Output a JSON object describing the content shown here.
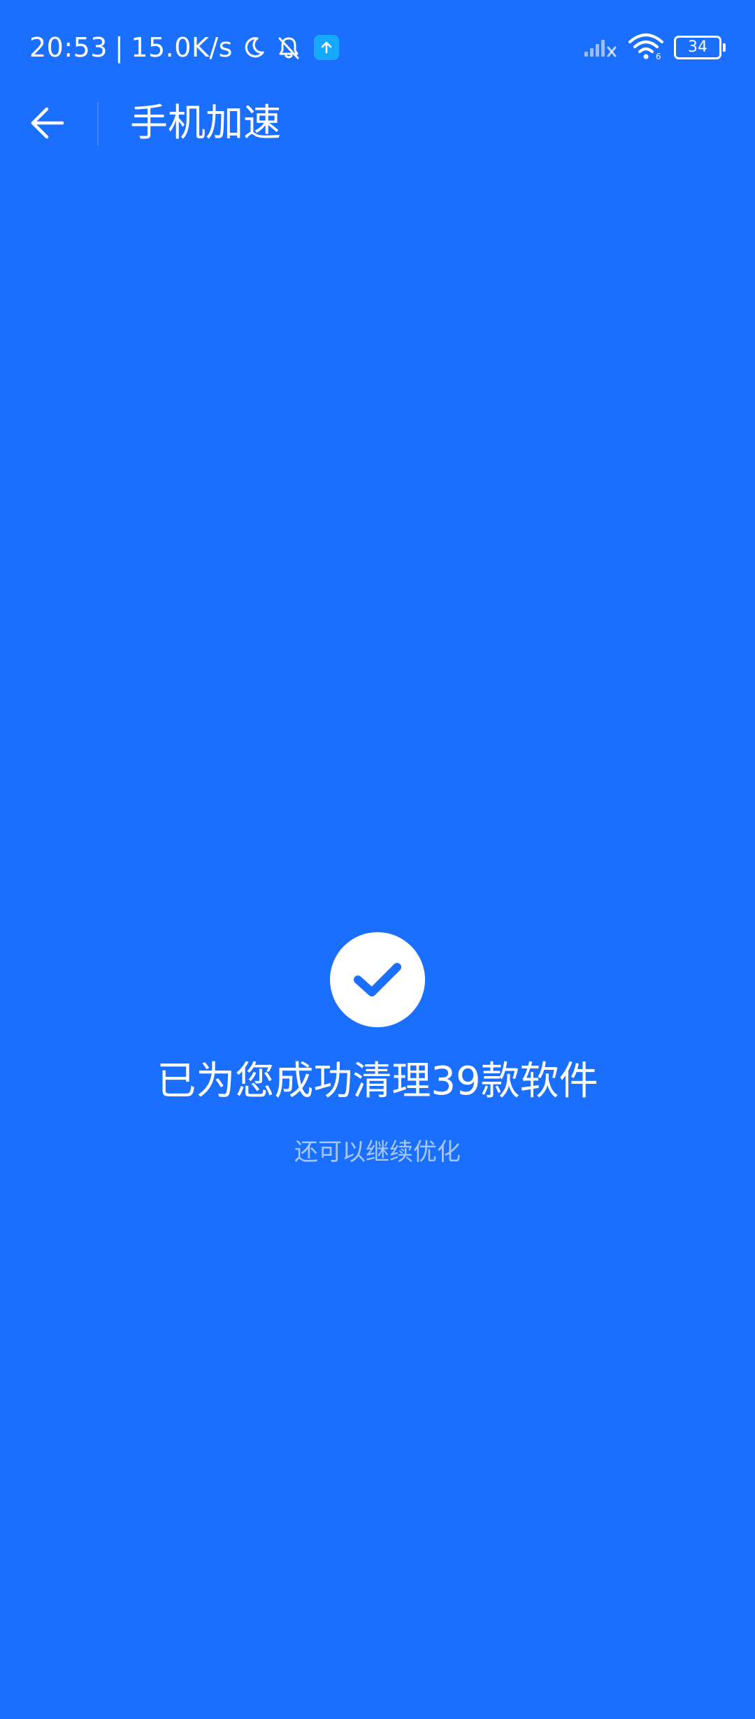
{
  "status_bar": {
    "time": "20:53",
    "separator": "|",
    "network_speed": "15.0K/s",
    "battery_level": "34",
    "icons": {
      "moon": "moon-icon",
      "mute": "bell-off-icon",
      "app": "upload-arrow-icon",
      "signal": "signal-no-service-icon",
      "wifi": "wifi-icon"
    },
    "app_badge_color": "#17a8ff"
  },
  "toolbar": {
    "title": "手机加速",
    "back_icon": "arrow-left-icon"
  },
  "result": {
    "icon": "check-circle-icon",
    "title": "已为您成功清理39款软件",
    "subtitle": "还可以继续优化"
  },
  "colors": {
    "background": "#1a6fff",
    "check_mark": "#1a6fff"
  }
}
